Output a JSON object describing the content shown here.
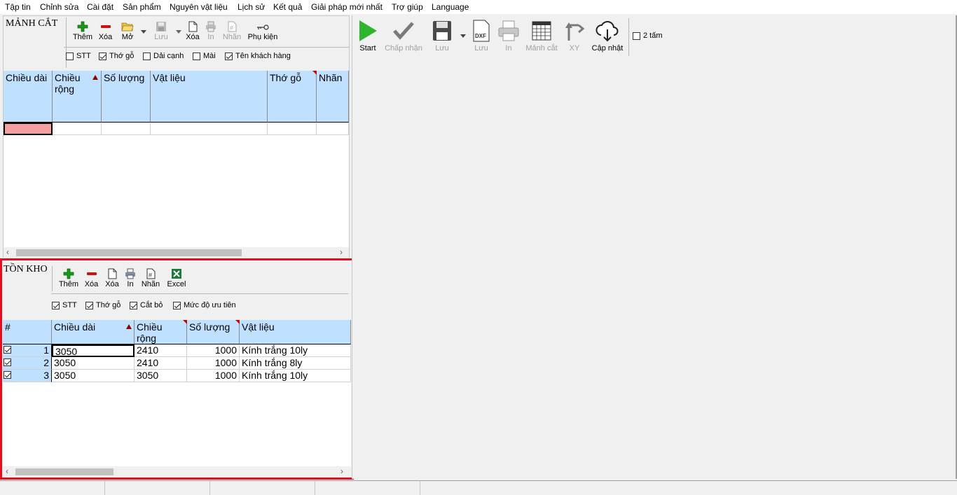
{
  "menu": [
    "Tập tin",
    "Chỉnh sửa",
    "Cài đặt",
    "Sản phẩm",
    "Nguyên vật liệu",
    "Lịch sử",
    "Kết quả",
    "Giải pháp mới nhất",
    "Trợ giúp",
    "Language"
  ],
  "pieces": {
    "title": "MẢNH CẮT",
    "toolbar": {
      "add": "Thêm",
      "delete": "Xóa",
      "open": "Mở",
      "save": "Lưu",
      "clear": "Xóa",
      "print": "In",
      "label": "Nhãn",
      "accessories": "Phụ kiện"
    },
    "options": [
      {
        "label": "STT",
        "checked": false
      },
      {
        "label": "Thớ gỗ",
        "checked": true
      },
      {
        "label": "Dải cạnh",
        "checked": false
      },
      {
        "label": "Mài",
        "checked": false
      },
      {
        "label": "Tên khách hàng",
        "checked": true
      }
    ],
    "columns": [
      "Chiều dài",
      "Chiều rộng",
      "Số lượng",
      "Vật liệu",
      "Thớ gỗ",
      "Nhãn"
    ]
  },
  "stock": {
    "title": "TỒN KHO",
    "toolbar": {
      "add": "Thêm",
      "delete": "Xóa",
      "clear": "Xóa",
      "print": "In",
      "label": "Nhãn",
      "excel": "Excel"
    },
    "options": [
      {
        "label": "STT",
        "checked": true
      },
      {
        "label": "Thớ gỗ",
        "checked": true
      },
      {
        "label": "Cắt bỏ",
        "checked": true
      },
      {
        "label": "Mức độ ưu tiên",
        "checked": true
      }
    ],
    "columns": [
      "#",
      "Chiều dài",
      "Chiều rộng",
      "Số lượng",
      "Vật liệu"
    ],
    "rows": [
      {
        "no": "1",
        "length": "3050",
        "width": "2410",
        "qty": "1000",
        "material": "Kính trắng 10ly"
      },
      {
        "no": "2",
        "length": "3050",
        "width": "2410",
        "qty": "1000",
        "material": "Kính trắng 8ly"
      },
      {
        "no": "3",
        "length": "3050",
        "width": "3050",
        "qty": "1000",
        "material": "Kính trắng 10ly"
      }
    ]
  },
  "results_toolbar": {
    "start": "Start",
    "accept": "Chấp nhận",
    "save": "Lưu",
    "save_dxf": "Lưu",
    "print": "In",
    "pieces": "Mảnh cắt",
    "xy": "XY",
    "update": "Cập nhật",
    "two_sheets": "2 tấm"
  },
  "colors": {
    "header": "#bfe0ff",
    "highlight_border": "#e0101e",
    "selected_cell": "#f4a0a0"
  }
}
